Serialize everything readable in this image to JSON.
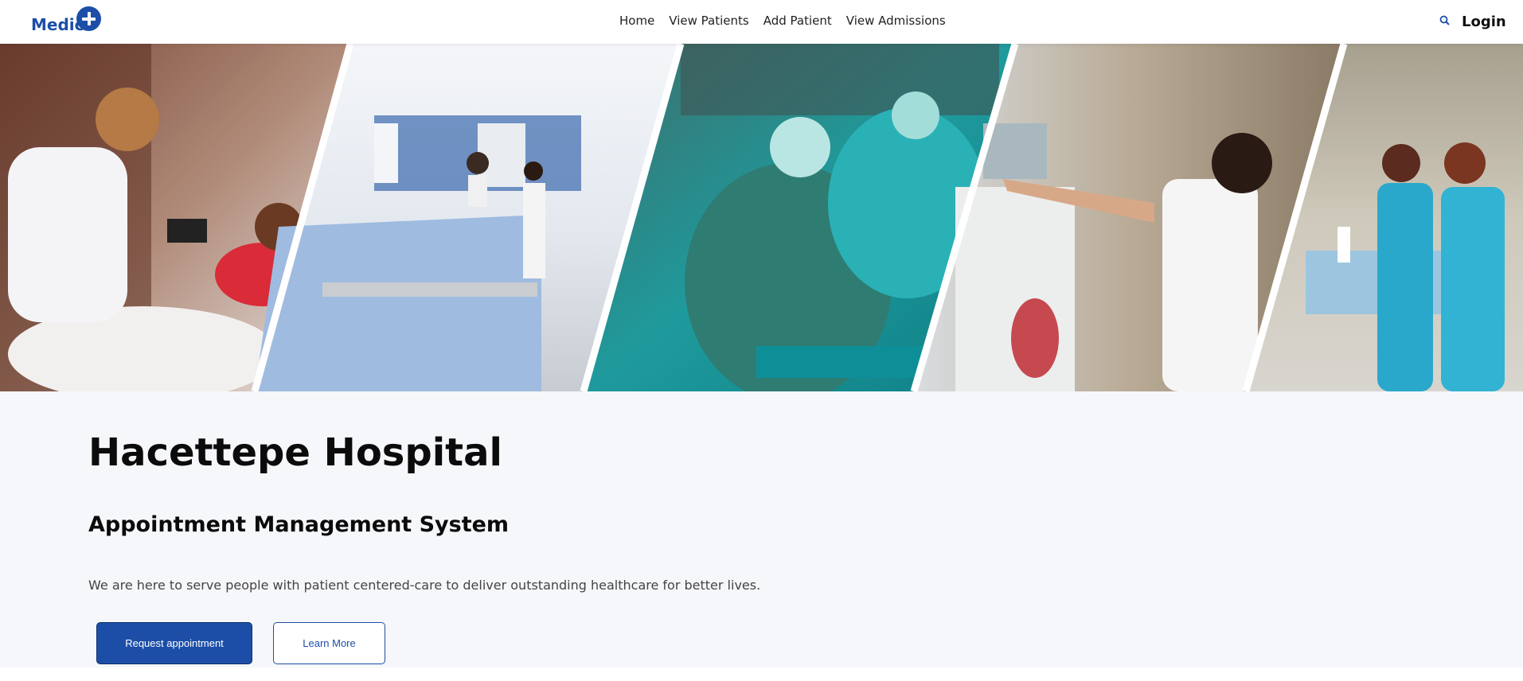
{
  "brand": {
    "name": "Medic"
  },
  "nav": {
    "items": [
      {
        "label": "Home"
      },
      {
        "label": "View Patients"
      },
      {
        "label": "Add Patient"
      },
      {
        "label": "View Admissions"
      }
    ],
    "search_icon": "search-icon",
    "login_label": "Login"
  },
  "hero": {
    "panels": [
      "nurse-checking-patient-blood-pressure",
      "hospital-reception-desk",
      "surgical-team-in-operating-room",
      "nurse-at-dialysis-machine",
      "nurses-in-hospital-ward"
    ]
  },
  "main": {
    "title": "Hacettepe Hospital",
    "subtitle": "Appointment Management System",
    "tagline": "We are here to serve people with patient centered-care to deliver outstanding healthcare for better lives.",
    "primary_button": "Request appointment",
    "secondary_button": "Learn More"
  },
  "colors": {
    "brand": "#1c4ea8",
    "content_background": "#f6f7fa"
  }
}
